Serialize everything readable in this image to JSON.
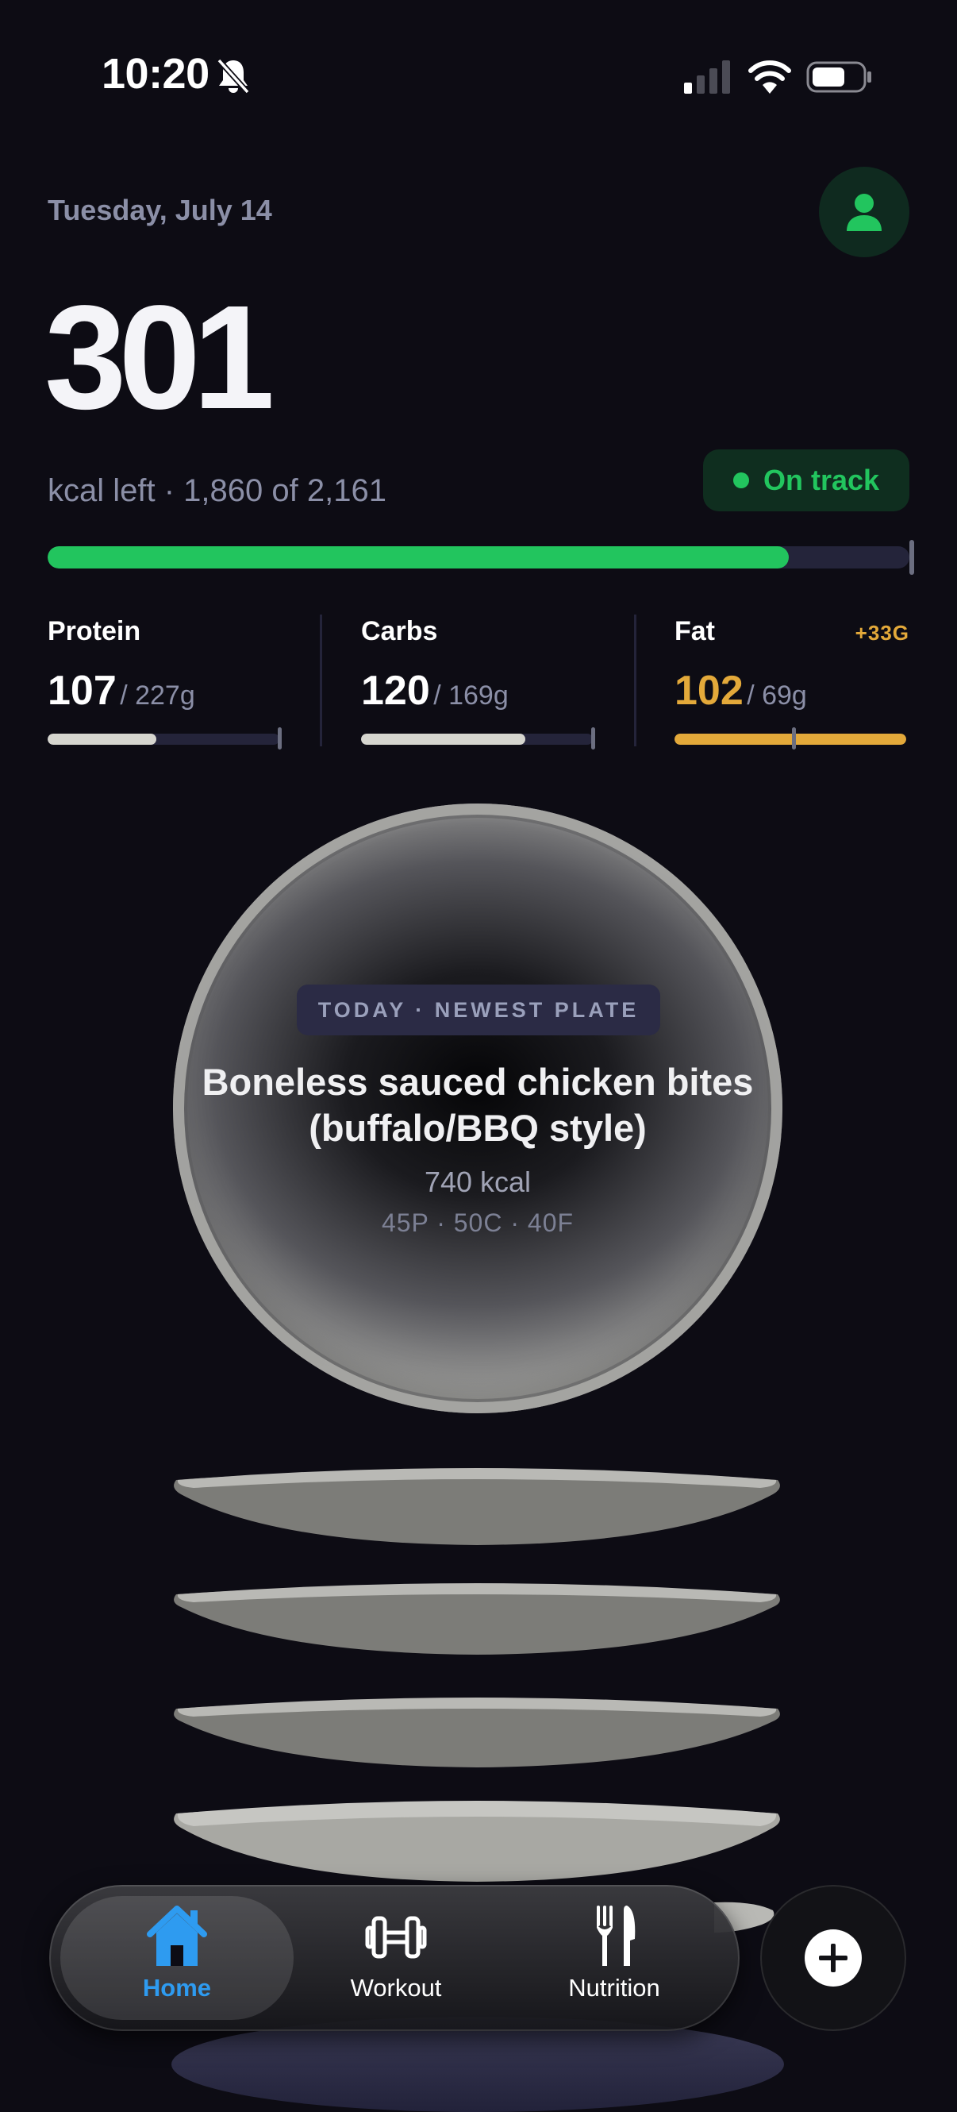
{
  "status_bar": {
    "time": "10:20",
    "icons": [
      "bell-slash-icon",
      "cellular-signal-icon",
      "wifi-icon",
      "battery-icon"
    ]
  },
  "header": {
    "date": "Tuesday, July 14",
    "profile_icon": "person-icon"
  },
  "calories": {
    "remaining": "301",
    "subtitle": "kcal left · 1,860 of 2,161",
    "progress_fraction": 0.86,
    "status": "On track"
  },
  "macros": [
    {
      "name": "Protein",
      "current": "107",
      "goal": "/ 227g",
      "progress_fraction": 0.47,
      "over": ""
    },
    {
      "name": "Carbs",
      "current": "120",
      "goal": "/ 169g",
      "progress_fraction": 0.71,
      "over": ""
    },
    {
      "name": "Fat",
      "current": "102",
      "goal": "/ 69g",
      "progress_fraction": 1.0,
      "over": "+33G"
    }
  ],
  "plate": {
    "tag": "TODAY · NEWEST PLATE",
    "title_line1": "Boneless sauced chicken bites",
    "title_line2": "(buffalo/BBQ style)",
    "kcal": "740 kcal",
    "macros": "45P · 50C · 40F"
  },
  "nav": {
    "items": [
      {
        "label": "Home",
        "icon": "house-icon",
        "active": true
      },
      {
        "label": "Workout",
        "icon": "dumbbell-icon",
        "active": false
      },
      {
        "label": "Nutrition",
        "icon": "fork-knife-icon",
        "active": false
      }
    ],
    "add_icon": "plus-icon"
  },
  "colors": {
    "background": "#0d0c14",
    "accent_green": "#22c55e",
    "accent_orange": "#e3a93a",
    "accent_blue": "#2e9bf0"
  }
}
